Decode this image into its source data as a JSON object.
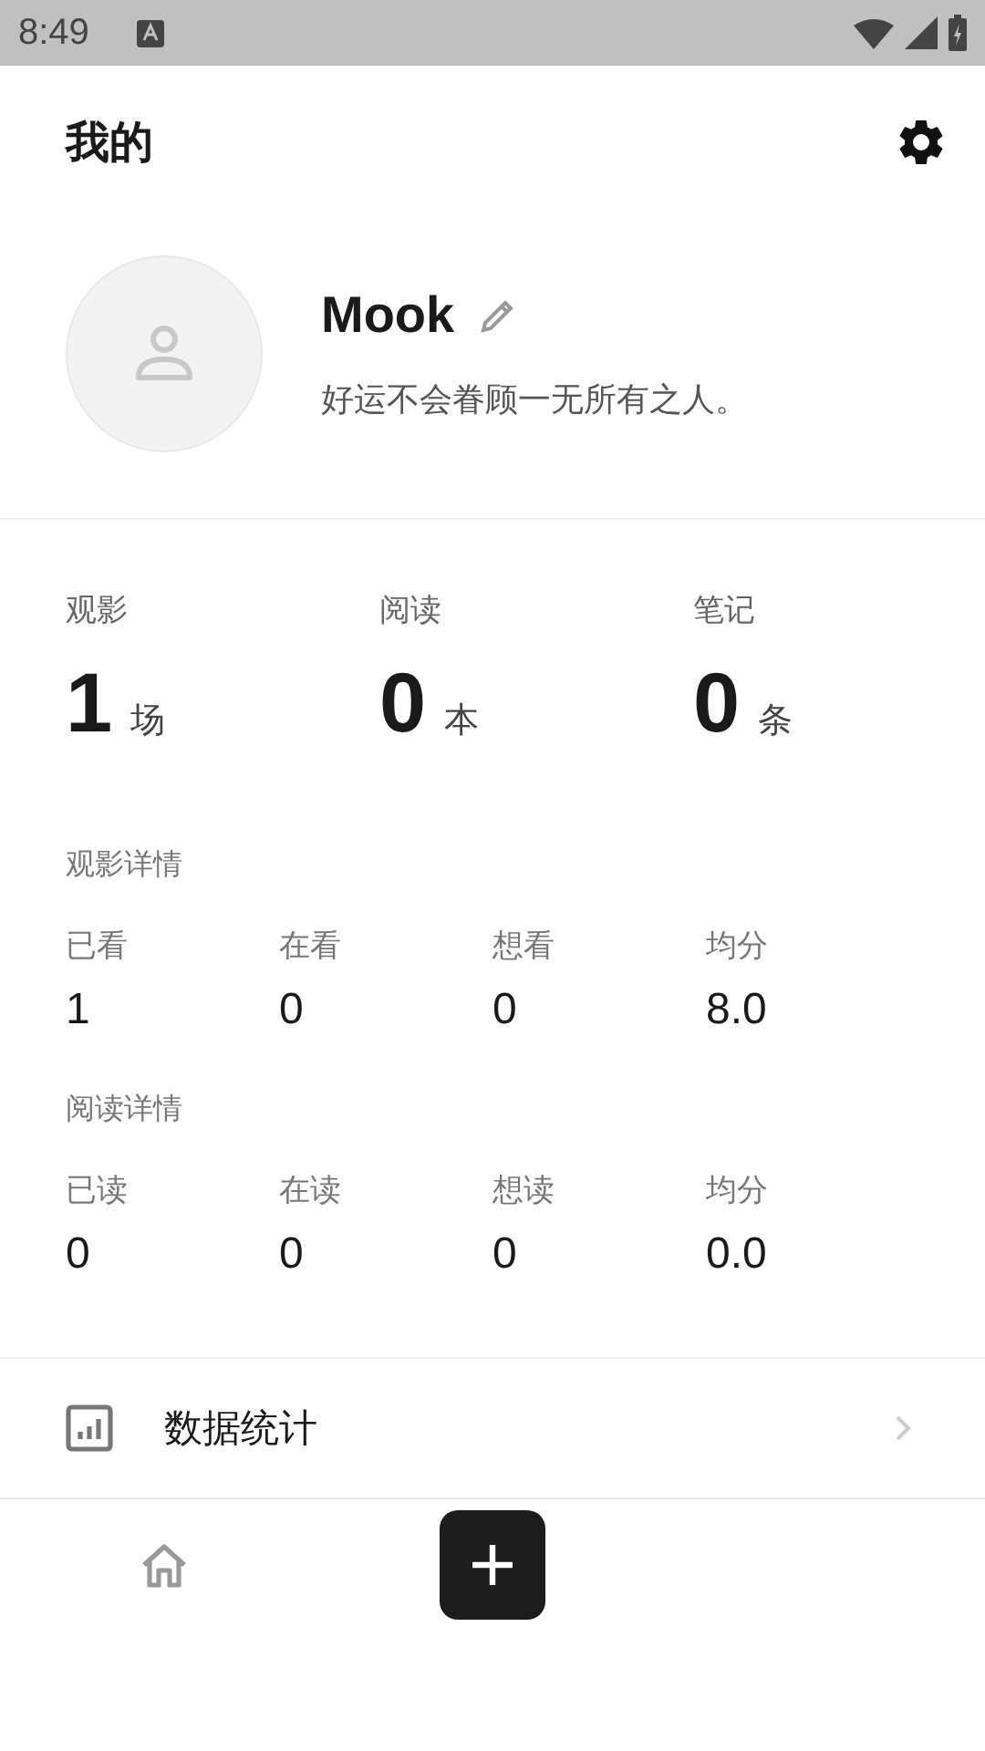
{
  "status_bar": {
    "time": "8:49"
  },
  "header": {
    "title": "我的"
  },
  "profile": {
    "name": "Mook",
    "motto": "好运不会眷顾一无所有之人。"
  },
  "stats": [
    {
      "label": "观影",
      "value": "1",
      "unit": "场"
    },
    {
      "label": "阅读",
      "value": "0",
      "unit": "本"
    },
    {
      "label": "笔记",
      "value": "0",
      "unit": "条"
    }
  ],
  "details": [
    {
      "title": "观影详情",
      "items": [
        {
          "label": "已看",
          "value": "1"
        },
        {
          "label": "在看",
          "value": "0"
        },
        {
          "label": "想看",
          "value": "0"
        },
        {
          "label": "均分",
          "value": "8.0"
        }
      ]
    },
    {
      "title": "阅读详情",
      "items": [
        {
          "label": "已读",
          "value": "0"
        },
        {
          "label": "在读",
          "value": "0"
        },
        {
          "label": "想读",
          "value": "0"
        },
        {
          "label": "均分",
          "value": "0.0"
        }
      ]
    }
  ],
  "menu": [
    {
      "label": "数据统计"
    }
  ],
  "bottom_nav": [
    {
      "kind": "home"
    },
    {
      "kind": "add"
    }
  ]
}
